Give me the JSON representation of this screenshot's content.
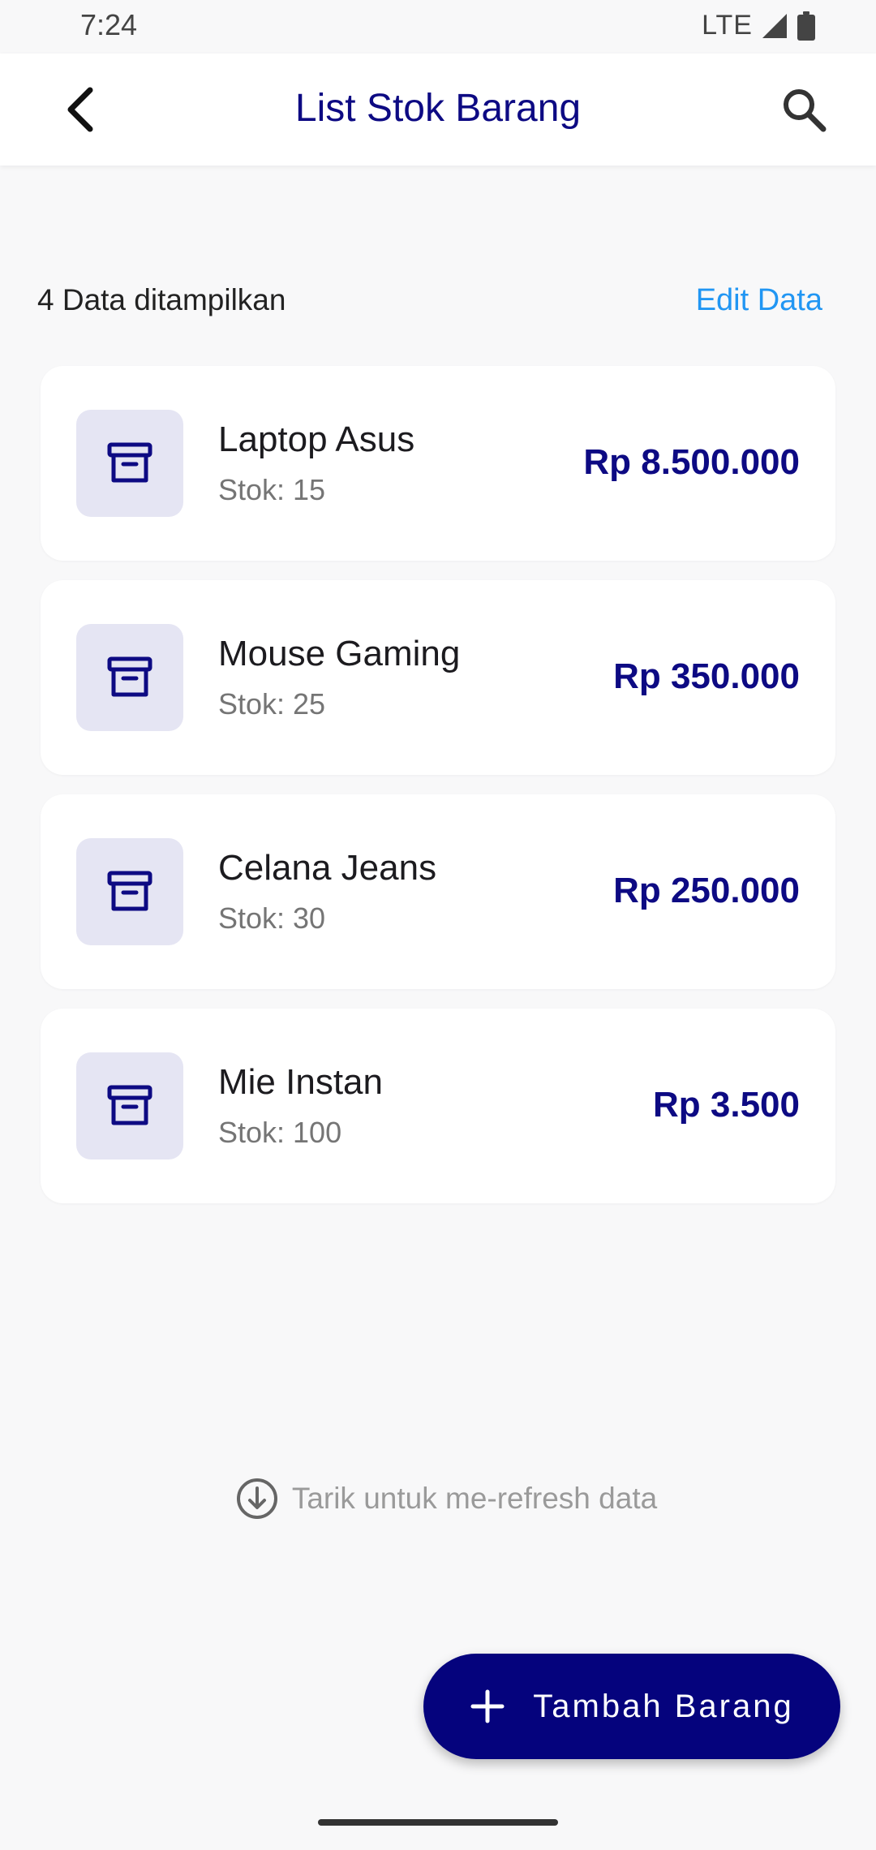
{
  "status_bar": {
    "time": "7:24",
    "network": "LTE",
    "icons": [
      "signal-icon",
      "battery-icon"
    ]
  },
  "app_bar": {
    "title": "List Stok Barang",
    "back_icon": "back-arrow-icon",
    "search_icon": "search-icon"
  },
  "list_header": {
    "count_text": "4 Data ditampilkan",
    "edit_label": "Edit Data"
  },
  "items": [
    {
      "name": "Laptop Asus",
      "stock": "Stok: 15",
      "price": "Rp 8.500.000",
      "icon": "archive-box-icon"
    },
    {
      "name": "Mouse Gaming",
      "stock": "Stok: 25",
      "price": "Rp 350.000",
      "icon": "archive-box-icon"
    },
    {
      "name": "Celana Jeans",
      "stock": "Stok: 30",
      "price": "Rp 250.000",
      "icon": "archive-box-icon"
    },
    {
      "name": "Mie Instan",
      "stock": "Stok: 100",
      "price": "Rp 3.500",
      "icon": "archive-box-icon"
    }
  ],
  "refresh_hint": {
    "text": "Tarik untuk me-refresh data",
    "icon": "arrow-down-circle-icon"
  },
  "fab": {
    "label": "Tambah Barang",
    "icon": "plus-icon"
  },
  "colors": {
    "primary": "#0d0a83",
    "accent_link": "#2196f3",
    "icon_bg": "#e5e5f3",
    "background": "#f8f8f9"
  }
}
